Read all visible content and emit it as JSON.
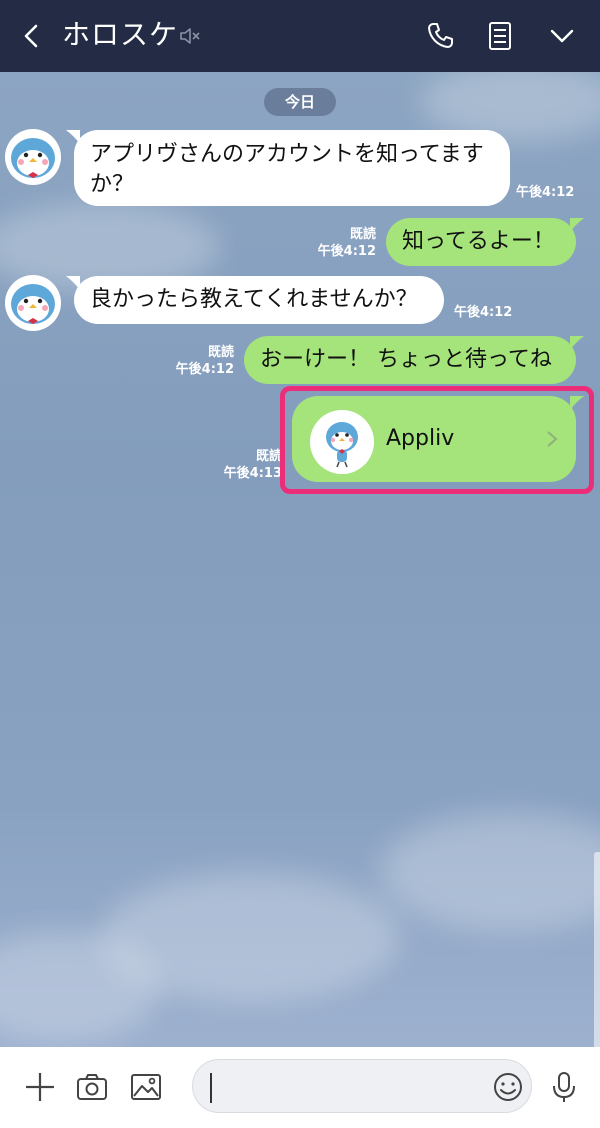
{
  "header": {
    "title": "ホロスケ",
    "back_icon": "chevron-left-icon",
    "mute_icon": "speaker-muted-icon",
    "call_icon": "phone-icon",
    "notes_icon": "note-icon",
    "menu_icon": "chevron-down-icon",
    "background_color": "#232c44"
  },
  "chat": {
    "date_label": "今日",
    "background_color": "#8aa2c0",
    "messages": [
      {
        "from": "other",
        "text": "アプリヴさんのアカウントを知ってますか？",
        "time": "午後4:12"
      },
      {
        "from": "me",
        "text": "知ってるよー！",
        "read": "既読",
        "time": "午後4:12"
      },
      {
        "from": "other",
        "text": "良かったら教えてくれませんか？",
        "time": "午後4:12"
      },
      {
        "from": "me",
        "text": "おーけー！ ちょっと待ってね",
        "read": "既読",
        "time": "午後4:12"
      }
    ],
    "shared_contact": {
      "name": "Appliv",
      "read": "既読",
      "time": "午後4:13",
      "highlight_color": "#ec2e78"
    },
    "incoming_bubble_color": "#ffffff",
    "outgoing_bubble_color": "#a5e37b"
  },
  "composer": {
    "plus_icon": "plus-icon",
    "camera_icon": "camera-icon",
    "image_icon": "image-icon",
    "emoji_icon": "smiley-icon",
    "mic_icon": "microphone-icon",
    "input_value": ""
  }
}
